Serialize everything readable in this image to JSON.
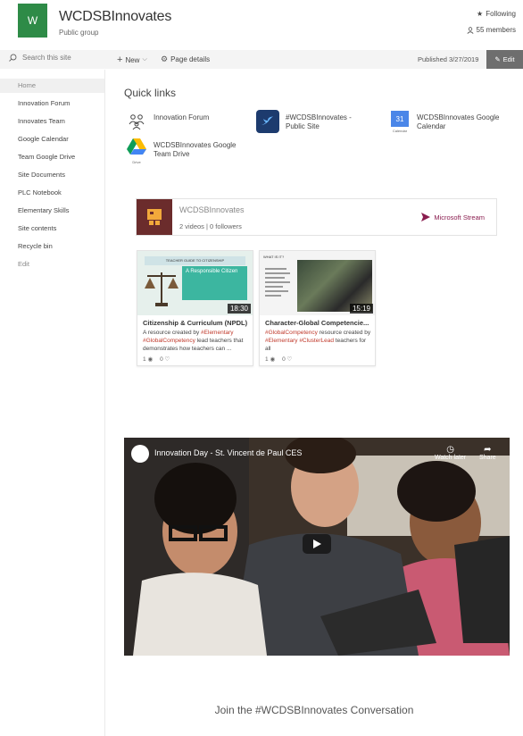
{
  "header": {
    "logo_letter": "W",
    "title": "WCDSBInnovates",
    "subtitle": "Public group",
    "following": "Following",
    "members": "55 members"
  },
  "command_bar": {
    "search_placeholder": "Search this site",
    "new_label": "New",
    "page_details_label": "Page details",
    "published": "Published 3/27/2019",
    "edit_label": "Edit"
  },
  "nav": {
    "items": [
      {
        "label": "Home"
      },
      {
        "label": "Innovation Forum"
      },
      {
        "label": "Innovates Team"
      },
      {
        "label": "Google Calendar"
      },
      {
        "label": "Team Google Drive"
      },
      {
        "label": "Site Documents"
      },
      {
        "label": "PLC Notebook"
      },
      {
        "label": "Elementary Skills"
      },
      {
        "label": "Site contents"
      },
      {
        "label": "Recycle bin"
      },
      {
        "label": "Edit"
      }
    ]
  },
  "quick_links": {
    "title": "Quick links",
    "items": [
      {
        "label": "Innovation Forum",
        "icon": "people-icon"
      },
      {
        "label_line1": "#WCDSBInnovates -",
        "label_line2": "Public Site",
        "icon": "twitter-icon"
      },
      {
        "label_line1": "WCDSBInnovates Google",
        "label_line2": "Calendar",
        "icon": "calendar-icon",
        "icon_text": "31",
        "icon_caption": "Calendar"
      },
      {
        "label_line1": "WCDSBInnovates Google",
        "label_line2": "Team Drive",
        "icon": "drive-icon",
        "icon_caption": "Drive"
      }
    ]
  },
  "stream": {
    "channel": "WCDSBInnovates",
    "meta": "2 videos | 0 followers",
    "brand": "Microsoft Stream",
    "brand_color": "#8a1d4f",
    "videos": [
      {
        "title": "Citizenship & Curriculum (NPDL)",
        "desc_prefix": "A resource created by ",
        "tag1": "#Elementary",
        "tag2": "#GlobalCompetency",
        "desc_suffix": " lead teachers that demonstrates how teachers can ...",
        "duration": "18:30",
        "thumb_header": "TEACHER GUIDE TO CITIZENSHIP",
        "thumb_title": "A Responsible Citizen",
        "views": "1",
        "likes": "0"
      },
      {
        "title": "Character-Global Competencie...",
        "tag1": "#GlobalCompetency",
        "mid1": " resource created by ",
        "tag2": "#Elementary",
        "tag3": "#ClusterLead",
        "desc_suffix": " teachers for all",
        "duration": "15:19",
        "thumb_header": "WHAT IS IT?",
        "views": "1",
        "likes": "0"
      }
    ]
  },
  "video": {
    "title": "Innovation Day - St. Vincent de Paul CES",
    "watch_later": "Watch later",
    "share": "Share"
  },
  "footer_heading": "Join the #WCDSBInnovates Conversation",
  "colors": {
    "logo": "#2e8b47",
    "edit_button": "#6e6e6e",
    "tag": "#c0392b"
  }
}
